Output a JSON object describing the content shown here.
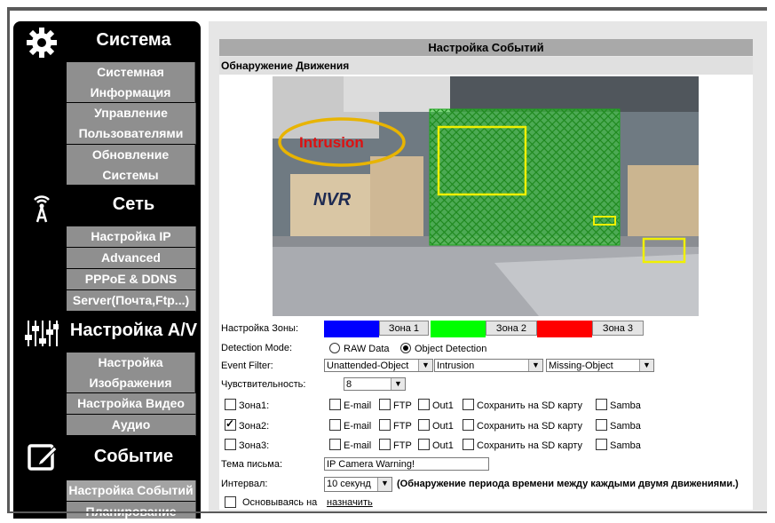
{
  "sidebar": {
    "sections": [
      {
        "title": "Система",
        "icon": "gear-icon",
        "items": [
          "Системная Информация",
          "Управление Пользователями",
          "Обновление Системы"
        ]
      },
      {
        "title": "Сеть",
        "icon": "antenna-icon",
        "items": [
          "Настройка IP",
          "Advanced",
          "PPPoE & DDNS",
          "Server(Почта,Ftp...)"
        ]
      },
      {
        "title": "Настройка A/V",
        "icon": "equalizer-icon",
        "items": [
          "Настройка Изображения",
          "Настройка Видео",
          "Аудио"
        ]
      },
      {
        "title": "Событие",
        "icon": "edit-icon",
        "items": [
          "Настройка Событий",
          "Планирование"
        ]
      }
    ],
    "active_item": "Настройка Событий"
  },
  "panel": {
    "title": "Настройка Событий",
    "subtitle": "Обнаружение Движения"
  },
  "camera": {
    "overlay_text": "Intrusion",
    "sign_text": "NVR"
  },
  "zones": {
    "label": "Настройка Зоны:",
    "buttons": [
      {
        "label": "Зона 1",
        "color": "#0000ff"
      },
      {
        "label": "Зона 2",
        "color": "#00ff00"
      },
      {
        "label": "Зона 3",
        "color": "#ff0000"
      }
    ]
  },
  "detection_mode": {
    "label": "Detection Mode:",
    "options": [
      "RAW Data",
      "Object Detection"
    ],
    "selected": "Object Detection"
  },
  "event_filter": {
    "label": "Event Filter:",
    "values": [
      "Unattended-Object",
      "Intrusion",
      "Missing-Object"
    ]
  },
  "sensitivity": {
    "label": "Чувствительность:",
    "value": "8"
  },
  "zone_rows": [
    {
      "label": "Зона1:",
      "checked": false
    },
    {
      "label": "Зона2:",
      "checked": true
    },
    {
      "label": "Зона3:",
      "checked": false
    }
  ],
  "actions": [
    "E-mail",
    "FTP",
    "Out1",
    "Сохранить на SD карту",
    "Samba"
  ],
  "email_subject": {
    "label": "Тема письма:",
    "value": "IP Camera Warning!"
  },
  "interval": {
    "label": "Интервал:",
    "value": "10 секунд",
    "note": "(Обнаружение периода времени между каждыми двумя движениями.)"
  },
  "schedule": {
    "prefix": "Основываясь на",
    "link": "назначить"
  },
  "colors": {
    "sidebar_bg": "#000000",
    "menu_button": "#8f8f8f",
    "panel_header": "#a9a9a9",
    "zone_overlay": "#33dd33",
    "intrusion_text": "#dd1111",
    "arrow": "#dd1111",
    "ellipse": "#e8b400"
  }
}
